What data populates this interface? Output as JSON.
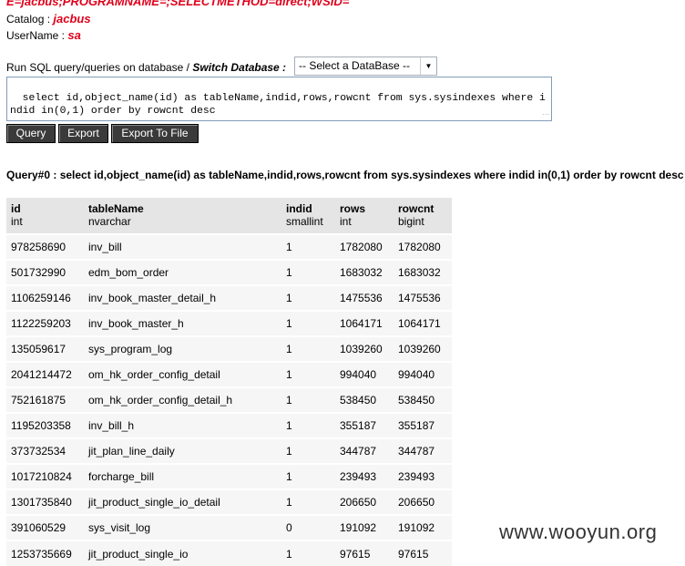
{
  "connection_string": "E=jacbus;PROGRAMNAME=;SELECTMETHOD=direct;WSID=",
  "catalog": {
    "label": "Catalog : ",
    "value": "jacbus"
  },
  "username": {
    "label": "UserName : ",
    "value": "sa"
  },
  "sql_section": {
    "prefix": "Run SQL query/queries on database / ",
    "switch_label": "Switch Database :",
    "database_select": "-- Select a DataBase --",
    "query_text": "select id,object_name(id) as tableName,indid,rows,rowcnt from sys.sysindexes where indid in(0,1) order by rowcnt desc"
  },
  "buttons": {
    "query": "Query",
    "export": "Export",
    "export_file": "Export To File"
  },
  "result_title": "Query#0 : select id,object_name(id) as tableName,indid,rows,rowcnt from sys.sysindexes where indid in(0,1) order by rowcnt desc",
  "table": {
    "columns": [
      {
        "name": "id",
        "type": "int"
      },
      {
        "name": "tableName",
        "type": "nvarchar"
      },
      {
        "name": "indid",
        "type": "smallint"
      },
      {
        "name": "rows",
        "type": "int"
      },
      {
        "name": "rowcnt",
        "type": "bigint"
      }
    ],
    "rows": [
      [
        "978258690",
        "inv_bill",
        "1",
        "1782080",
        "1782080"
      ],
      [
        "501732990",
        "edm_bom_order",
        "1",
        "1683032",
        "1683032"
      ],
      [
        "1106259146",
        "inv_book_master_detail_h",
        "1",
        "1475536",
        "1475536"
      ],
      [
        "1122259203",
        "inv_book_master_h",
        "1",
        "1064171",
        "1064171"
      ],
      [
        "135059617",
        "sys_program_log",
        "1",
        "1039260",
        "1039260"
      ],
      [
        "2041214472",
        "om_hk_order_config_detail",
        "1",
        "994040",
        "994040"
      ],
      [
        "752161875",
        "om_hk_order_config_detail_h",
        "1",
        "538450",
        "538450"
      ],
      [
        "1195203358",
        "inv_bill_h",
        "1",
        "355187",
        "355187"
      ],
      [
        "373732534",
        "jit_plan_line_daily",
        "1",
        "344787",
        "344787"
      ],
      [
        "1017210824",
        "forcharge_bill",
        "1",
        "239493",
        "239493"
      ],
      [
        "1301735840",
        "jit_product_single_io_detail",
        "1",
        "206650",
        "206650"
      ],
      [
        "391060529",
        "sys_visit_log",
        "0",
        "191092",
        "191092"
      ],
      [
        "1253735669",
        "jit_product_single_io",
        "1",
        "97615",
        "97615"
      ]
    ]
  },
  "watermark": "www.wooyun.org"
}
